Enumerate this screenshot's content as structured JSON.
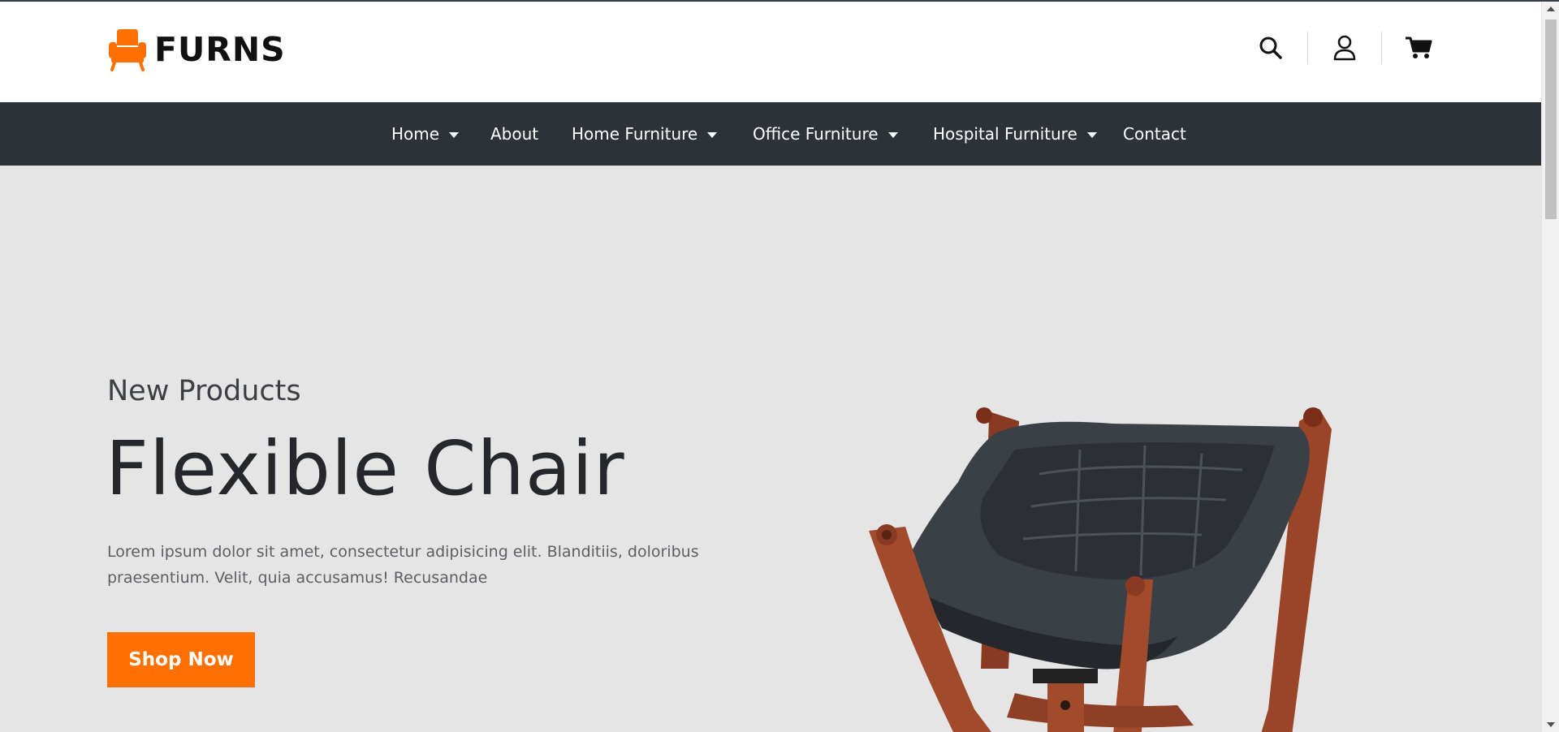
{
  "brand": {
    "name": "FURNS",
    "accent_color": "#ff7004"
  },
  "header": {
    "icons": [
      "search-icon",
      "user-icon",
      "cart-icon"
    ]
  },
  "nav": {
    "background": "#2d3238",
    "items": [
      {
        "label": "Home",
        "has_dropdown": true
      },
      {
        "label": "About",
        "has_dropdown": false
      },
      {
        "label": "Home Furniture",
        "has_dropdown": true
      },
      {
        "label": "Office Furniture",
        "has_dropdown": true
      },
      {
        "label": "Hospital Furniture",
        "has_dropdown": true
      },
      {
        "label": "Contact",
        "has_dropdown": false
      }
    ]
  },
  "hero": {
    "subtitle": "New Products",
    "title": "Flexible Chair",
    "description": "Lorem ipsum dolor sit amet, consectetur adipisicing elit. Blanditiis, doloribus praesentium. Velit, quia accusamus! Recusandae",
    "cta_label": "Shop Now",
    "background": "#e6e5e5",
    "image": "leather-chair-image"
  }
}
